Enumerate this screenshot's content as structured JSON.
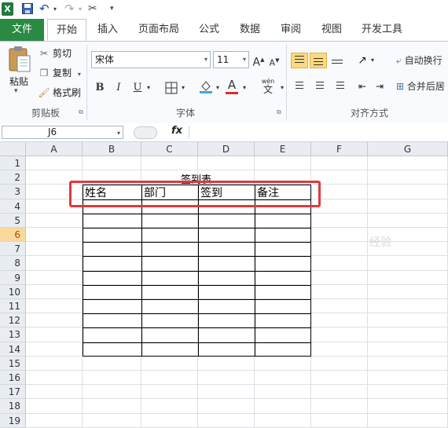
{
  "qat": {
    "logo": "X",
    "undo": "↶",
    "redo": "↷",
    "more": "▾"
  },
  "tabs": [
    "文件",
    "开始",
    "插入",
    "页面布局",
    "公式",
    "数据",
    "审阅",
    "视图",
    "开发工具"
  ],
  "ribbon": {
    "clipboard": {
      "paste": "粘贴",
      "cut": "剪切",
      "copy": "复制",
      "format_painter": "格式刷",
      "label": "剪贴板"
    },
    "font": {
      "name": "宋体",
      "size": "11",
      "bold": "B",
      "italic": "I",
      "underline": "U",
      "font_color": "A",
      "phonetic": "wén",
      "label": "字体"
    },
    "alignment": {
      "wrap_text": "自动换行",
      "merge_center": "合并后居",
      "label": "对齐方式"
    }
  },
  "formula_bar": {
    "name_box": "J6",
    "fx": "fx",
    "value": ""
  },
  "sheet": {
    "columns": [
      "A",
      "B",
      "C",
      "D",
      "E",
      "F",
      "G"
    ],
    "rows": [
      "1",
      "2",
      "3",
      "4",
      "5",
      "6",
      "7",
      "8",
      "9",
      "10",
      "11",
      "12",
      "13",
      "14",
      "15",
      "16",
      "17",
      "18",
      "19"
    ],
    "selected_row": "6",
    "title": "签到表",
    "headers": [
      "姓名",
      "部门",
      "签到",
      "备注"
    ]
  },
  "watermark": "经验"
}
